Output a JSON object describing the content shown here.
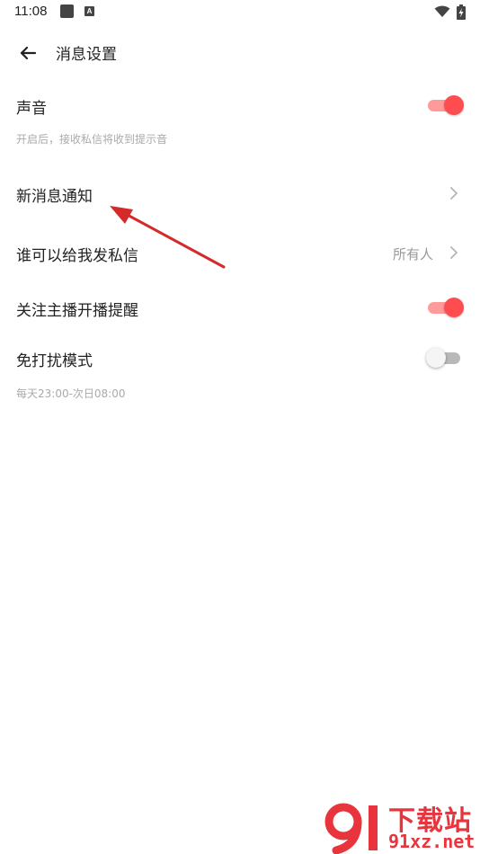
{
  "status_bar": {
    "time": "11:08",
    "a_icon_label": "A"
  },
  "header": {
    "title": "消息设置"
  },
  "settings": {
    "sound": {
      "label": "声音",
      "subtitle": "开启后，接收私信将收到提示音",
      "enabled": true
    },
    "new_message_notify": {
      "label": "新消息通知"
    },
    "who_can_message": {
      "label": "谁可以给我发私信",
      "value": "所有人"
    },
    "follow_live_remind": {
      "label": "关注主播开播提醒",
      "enabled": true
    },
    "do_not_disturb": {
      "label": "免打扰模式",
      "subtitle": "每天23:00-次日08:00",
      "enabled": false
    }
  },
  "colors": {
    "accent": "#ff4d4f",
    "accent_track": "#ff9a9a",
    "annotation_arrow": "#d42a2a",
    "watermark": "#e8343c"
  },
  "watermark": {
    "title": "下载站",
    "url": "91xz.net"
  }
}
